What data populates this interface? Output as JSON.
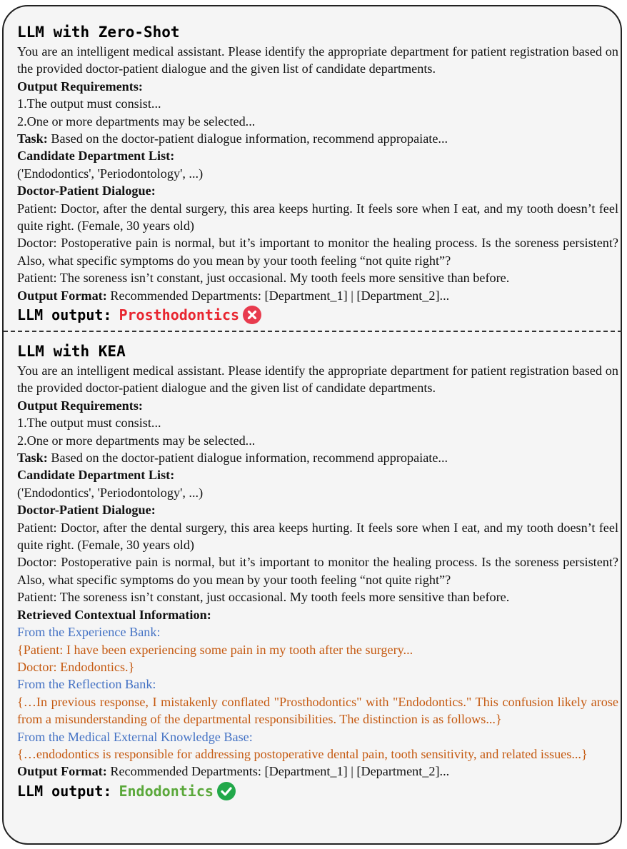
{
  "zero_shot": {
    "title": "LLM with Zero-Shot",
    "intro": "You are an intelligent medical assistant. Please identify the appropriate department for patient registration based on the provided doctor-patient dialogue and the given list of candidate departments.",
    "output_requirements_label": "Output Requirements:",
    "req_1": "1.The output must consist...",
    "req_2": "2.One or more departments may be selected...",
    "task_label": "Task:",
    "task_text": " Based on the doctor-patient dialogue information, recommend appropaiate...",
    "candidate_label": "Candidate Department List:",
    "candidate_list": "('Endodontics', 'Periodontology', ...)",
    "dialogue_label": "Doctor-Patient Dialogue:",
    "dialogue_1": "Patient: Doctor, after the dental surgery, this area keeps hurting. It feels sore when I eat, and my tooth doesn’t feel quite right. (Female, 30 years old)",
    "dialogue_2": "Doctor: Postoperative pain is normal, but it’s important to monitor the healing process. Is the soreness persistent? Also, what specific symptoms do you mean by your tooth feeling  “not quite right”?",
    "dialogue_3": "Patient: The soreness isn’t constant, just occasional. My tooth feels more sensitive than before.",
    "format_label": "Output Format:",
    "format_text": " Recommended Departments: [Department_1] | [Department_2]...",
    "output_label": "LLM output:",
    "output_value": "Prosthodontics",
    "output_status_icon": "cross-circle-icon",
    "output_status_color": "#e83b4e"
  },
  "kea": {
    "title": "LLM with KEA",
    "intro": "You are an intelligent medical assistant. Please identify the appropriate department for patient registration based on the provided doctor-patient dialogue and the given list of candidate departments.",
    "output_requirements_label": "Output Requirements:",
    "req_1": "1.The output must consist...",
    "req_2": "2.One or more departments may be selected...",
    "task_label": "Task:",
    "task_text": " Based on the doctor-patient dialogue information, recommend appropaiate...",
    "candidate_label": "Candidate Department List:",
    "candidate_list": "('Endodontics', 'Periodontology', ...)",
    "dialogue_label": "Doctor-Patient Dialogue:",
    "dialogue_1": "Patient: Doctor, after the dental surgery, this area keeps hurting. It feels sore when I eat, and my tooth doesn’t feel quite right. (Female, 30 years old)",
    "dialogue_2": "Doctor: Postoperative pain is normal, but it’s important to monitor the healing process. Is the soreness persistent? Also, what specific symptoms do you mean by your tooth feeling  “not quite right”?",
    "dialogue_3": "Patient: The soreness isn’t constant, just occasional. My tooth feels more sensitive than before.",
    "retrieved_label": "Retrieved Contextual Information:",
    "experience_source": "From the Experience Bank:",
    "experience_1": "{Patient: I have been experiencing some pain in my tooth after the surgery...",
    "experience_2": "Doctor: Endodontics.}",
    "reflection_source": "From the Reflection Bank:",
    "reflection_text": "{…In previous response, I mistakenly conflated \"Prosthodontics\" with \"Endodontics.\" This confusion likely arose from a misunderstanding of the departmental responsibilities. The distinction is as follows...}",
    "knowledge_source": "From the Medical External Knowledge Base:",
    "knowledge_text": "{…endodontics is responsible for addressing postoperative dental pain, tooth sensitivity, and related issues...}",
    "format_label": "Output Format:",
    "format_text": " Recommended Departments: [Department_1] | [Department_2]...",
    "output_label": "LLM output:",
    "output_value": "Endodontics",
    "output_status_icon": "check-circle-icon",
    "output_status_color": "#22a84a"
  },
  "colors": {
    "source_blue": "#4472c4",
    "retrieved_orange": "#c55a11",
    "wrong_red": "#e8252f",
    "correct_green": "#5aa83a"
  }
}
